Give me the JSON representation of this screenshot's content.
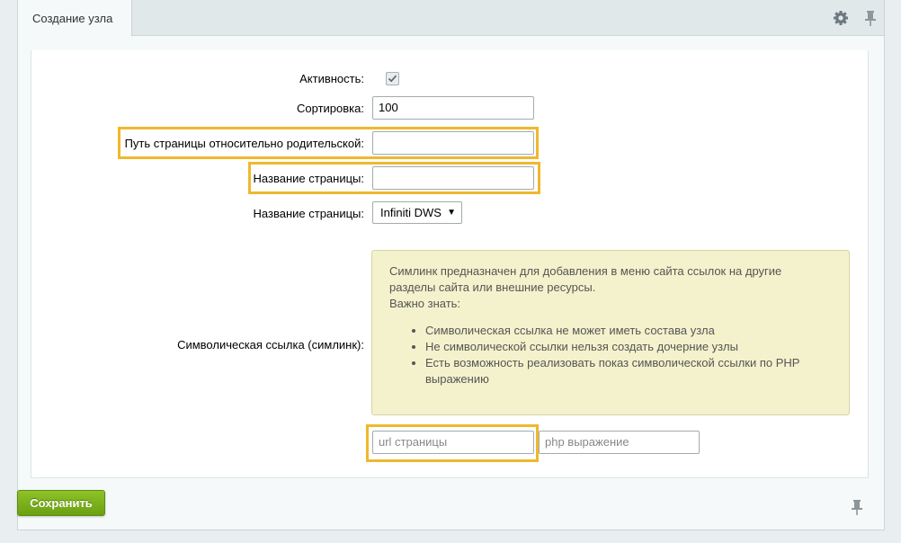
{
  "tab": {
    "title": "Создание узла"
  },
  "form": {
    "activity_label": "Активность:",
    "activity_checked": true,
    "sort_label": "Сортировка:",
    "sort_value": "100",
    "path_label": "Путь страницы относительно родительской:",
    "path_value": "",
    "page_name_label": "Название страницы:",
    "page_name_value": "",
    "site_label": "Название страницы:",
    "site_selected": "Infiniti DWS",
    "symlink_label": "Символическая ссылка (симлинк):",
    "url_placeholder": "url страницы",
    "php_placeholder": "php выражение"
  },
  "note": {
    "line1": "Симлинк предназначен для добавления в меню сайта ссылок на другие",
    "line2": "разделы сайта или внешние ресурсы.",
    "line3": "Важно знать:",
    "items": [
      "Символическая ссылка не может иметь состава узла",
      "Не символической ссылки нельзя создать дочерние узлы",
      "Есть возможность реализовать показ символической ссылки по PHP выражению"
    ]
  },
  "footer": {
    "save_label": "Сохранить"
  },
  "colors": {
    "highlight": "#efb82d",
    "save_button": "#7aaf1a",
    "note_bg": "#f4f2cc"
  }
}
